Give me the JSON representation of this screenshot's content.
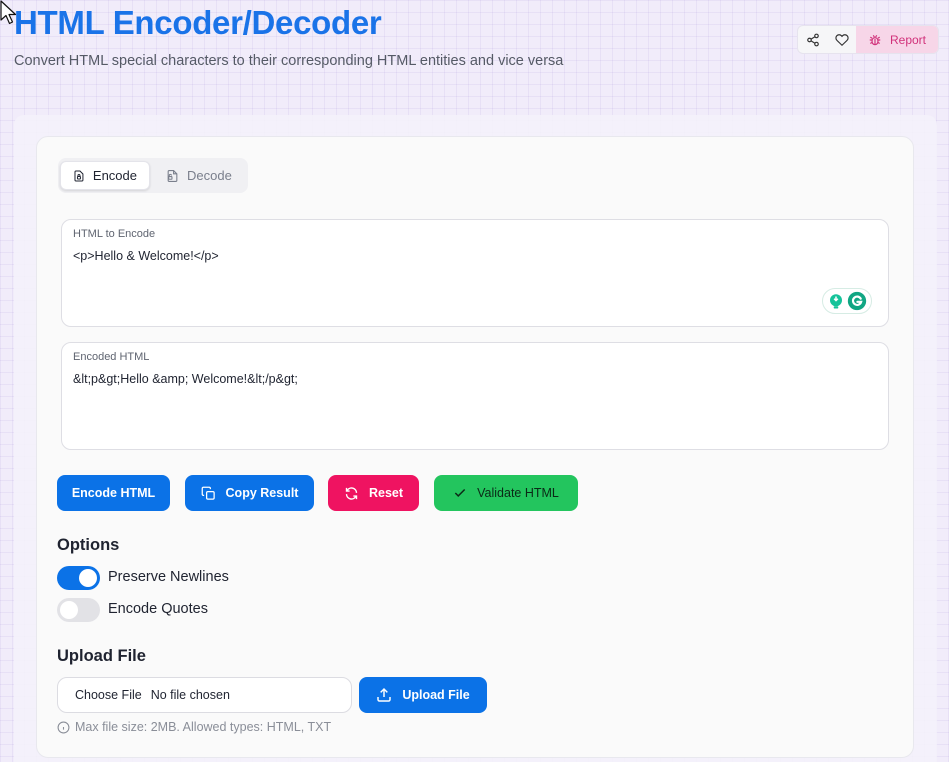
{
  "header": {
    "title": "HTML Encoder/Decoder",
    "subtitle": "Convert HTML special characters to their corresponding HTML entities and vice versa",
    "report_label": "Report"
  },
  "tabs": [
    {
      "label": "Encode",
      "active": true
    },
    {
      "label": "Decode",
      "active": false
    }
  ],
  "input": {
    "label": "HTML to Encode",
    "value": "<p>Hello & Welcome!</p>"
  },
  "output": {
    "label": "Encoded HTML",
    "value": "&lt;p&gt;Hello &amp; Welcome!&lt;/p&gt;"
  },
  "actions": {
    "encode_label": "Encode HTML",
    "copy_label": "Copy Result",
    "reset_label": "Reset",
    "validate_label": "Validate HTML"
  },
  "options": {
    "title": "Options",
    "preserve_newlines": {
      "label": "Preserve Newlines",
      "enabled": true
    },
    "encode_quotes": {
      "label": "Encode Quotes",
      "enabled": false
    }
  },
  "upload": {
    "title": "Upload File",
    "choose_label": "Choose File",
    "no_file_label": "No file chosen",
    "upload_label": "Upload File",
    "hint": "Max file size: 2MB. Allowed types: HTML, TXT"
  },
  "colors": {
    "primary": "#0b72e7",
    "title_blue": "#1a73e8",
    "reset_pink": "#ef1361",
    "validate_green": "#23c55e",
    "report_bg": "#f7d6e8",
    "report_text": "#d1317a"
  },
  "icons": {
    "share": "share-icon",
    "favorite": "heart-icon",
    "report": "bug-icon",
    "encode_tab": "file-lock-icon",
    "decode_tab": "file-unlock-icon",
    "copy": "copy-icon",
    "reset": "refresh-icon",
    "validate": "check-icon",
    "upload": "upload-icon",
    "info": "info-icon"
  }
}
